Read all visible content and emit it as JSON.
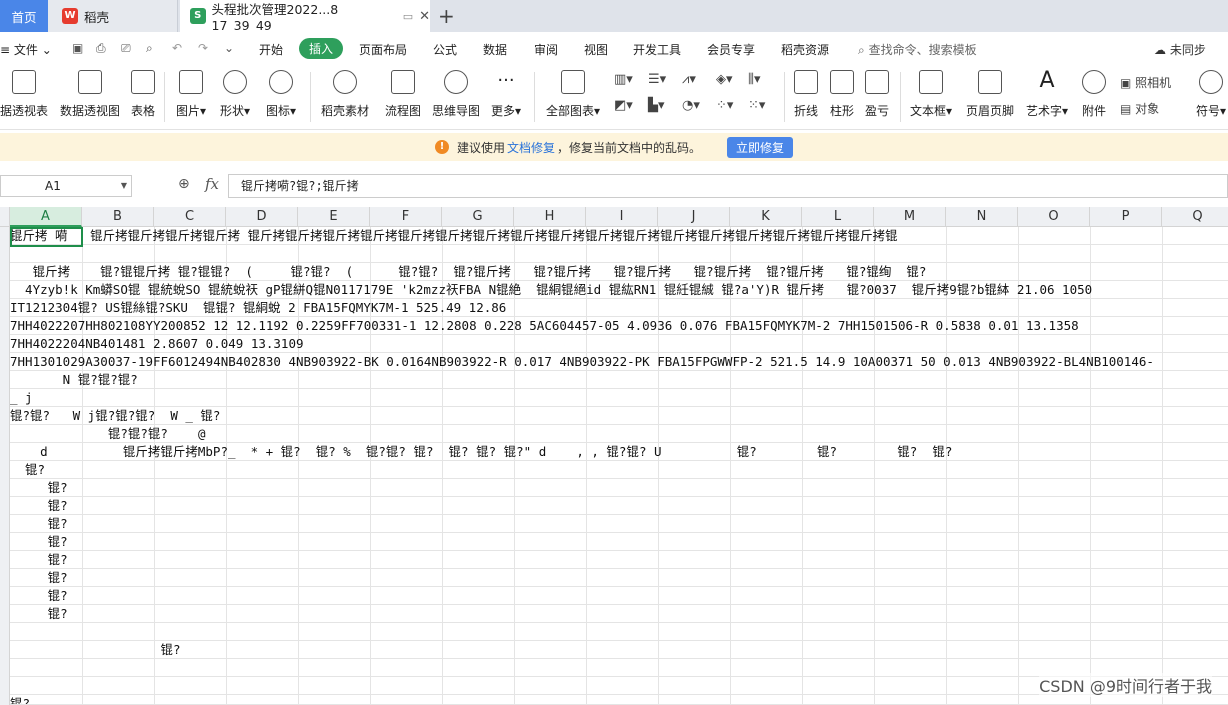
{
  "tabs": {
    "home": "首页",
    "daoke": "稻壳",
    "file": "头程批次管理2022...8 17_39_49"
  },
  "menu": {
    "file": "文件",
    "items": [
      "开始",
      "插入",
      "页面布局",
      "公式",
      "数据",
      "审阅",
      "视图",
      "开发工具",
      "会员专享",
      "稻壳资源"
    ],
    "search": "查找命令、搜索模板",
    "sync": "未同步"
  },
  "ribbon": {
    "buttons": [
      "据透视表",
      "数据透视图",
      "表格",
      "图片",
      "形状",
      "图标",
      "稻壳素材",
      "流程图",
      "思维导图",
      "更多",
      "全部图表",
      "折线",
      "柱形",
      "盈亏",
      "文本框",
      "页眉页脚",
      "艺术字",
      "附件",
      "照相机",
      "对象",
      "符号"
    ]
  },
  "notice": {
    "pre": "建议使用",
    "link": "文档修复",
    "post": "，修复当前文档中的乱码。",
    "button": "立即修复"
  },
  "formula": {
    "cell": "A1",
    "fx": "fx",
    "content": "锟斤拷嗬?锟?;锟斤拷"
  },
  "columns": [
    "A",
    "B",
    "C",
    "D",
    "E",
    "F",
    "G",
    "H",
    "I",
    "J",
    "K",
    "L",
    "M",
    "N",
    "O",
    "P",
    "Q"
  ],
  "rows": [
    "锟斤拷 嗬   锟斤拷锟斤拷锟斤拷锟斤拷 锟斤拷锟斤拷锟斤拷锟斤拷锟斤拷锟斤拷锟斤拷锟斤拷锟斤拷锟斤拷锟斤拷锟斤拷锟斤拷锟斤拷锟斤拷锟斤拷锟斤拷锟",
    "",
    "   锟斤拷    锟?锟锟斤拷 锟?锟锟?  (     锟?锟?  (      锟?锟?  锟?锟斤拷   锟?锟斤拷   锟?锟斤拷   锟?锟斤拷  锟?锟斤拷   锟?锟绚  锟?",
    "  4Yzyb!k Km蟒SO锟 锟統蛻SO 锟統蛻祆 gP锟絣Q锟N0117179E 'k2mzz祆FBA N锟絶  锟絧锟絕id 锟紘RN1 锟紝锟絾 锟?a'Y)R 锟斤拷   锟?0037  锟斤拷9锟?b锟絊 21.06 1050",
    "IT1212304锟? US锟絲锟?SKU  锟锟? 锟絧蛻 2 FBA15FQMYK7M-1 525.49 12.86",
    "7HH4022207HH802108YY200852 12 12.1192 0.2259FF700331-1 12.2808 0.228 5AC604457-05 4.0936 0.076 FBA15FQMYK7M-2 7HH1501506-R 0.5838 0.01 13.1358",
    "7HH4022204NB401481 2.8607 0.049 13.3109",
    "7HH1301029A30037-19FF6012494NB402830 4NB903922-BK 0.0164NB903922-R 0.017 4NB903922-PK FBA15FPGWWFP-2 521.5 14.9 10A00371 50 0.013 4NB903922-BL4NB100146-",
    "       N 锟?锟?锟?",
    "_ j",
    "锟?锟?   W j锟?锟?锟?  W _ 锟?",
    "             锟?锟?锟?    @",
    "    d          锟斤拷锟斤拷MbP?_  * + 锟?  锟? %  锟?锟? 锟?  锟? 锟? 锟?\" d    , , 锟?锟? U          锟?        锟?        锟?  锟?",
    "  锟?",
    "     锟?",
    "     锟?",
    "     锟?",
    "     锟?",
    "     锟?",
    "     锟?",
    "     锟?",
    "     锟?",
    "",
    "                    锟?",
    "",
    "",
    "锟?",
    "  锟?"
  ],
  "watermark": "CSDN @9时间行者于我"
}
